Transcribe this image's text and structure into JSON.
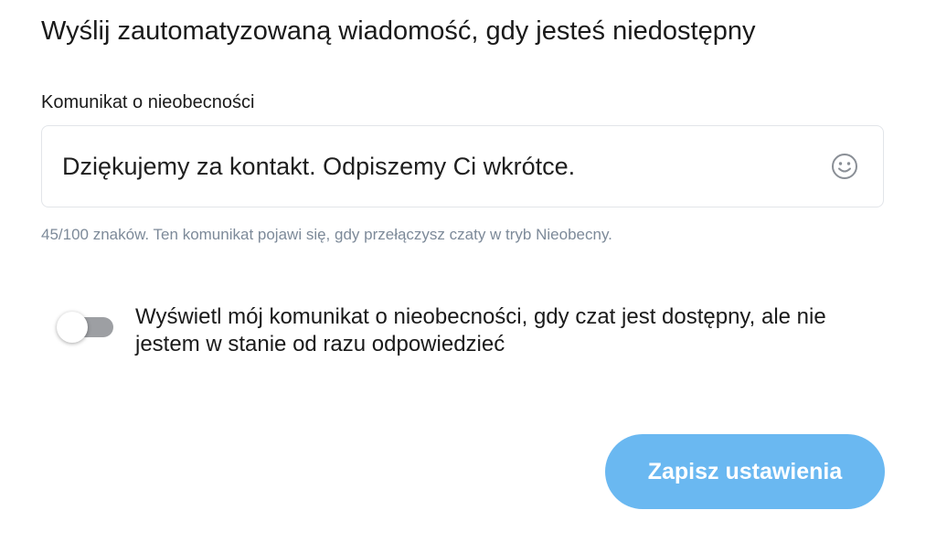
{
  "heading": "Wyślij zautomatyzowaną wiadomość, gdy jesteś niedostępny",
  "away_message": {
    "label": "Komunikat o nieobecności",
    "value": "Dziękujemy za kontakt. Odpiszemy Ci wkrótce.",
    "emoji_icon": "smiley-face-icon",
    "helper_text": "45/100 znaków. Ten komunikat pojawi się, gdy przełączysz czaty w tryb Nieobecny."
  },
  "toggle": {
    "label": "Wyświetl mój komunikat o nieobecności, gdy czat jest dostępny, ale nie jestem w stanie od razu odpowiedzieć",
    "checked": false
  },
  "save_button": {
    "label": "Zapisz ustawienia"
  },
  "colors": {
    "button": "#6ab8f1",
    "helper_text": "#7d8a99",
    "toggle_track_off": "#9d9fa3",
    "input_border": "#e2e5e9"
  }
}
